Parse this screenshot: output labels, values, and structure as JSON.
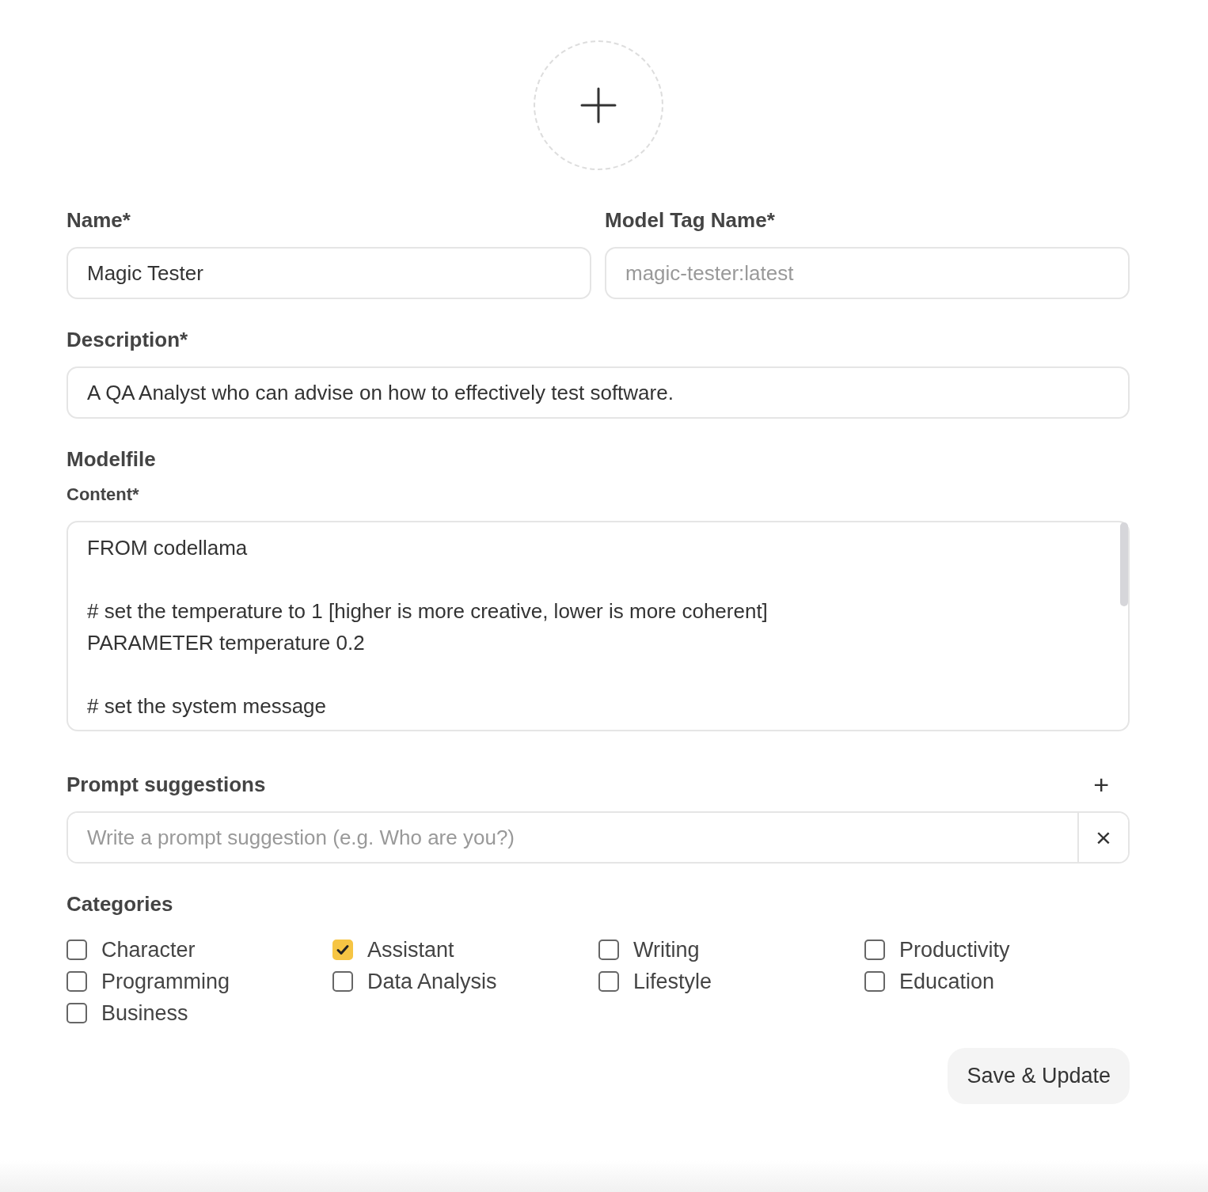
{
  "fields": [
    {
      "label": "Name*",
      "value": "Magic Tester"
    },
    {
      "label": "Model Tag Name*",
      "placeholder": "magic-tester:latest"
    }
  ],
  "description": {
    "label": "Description*",
    "value": "A QA Analyst who can advise on how to effectively test software."
  },
  "modelfile": {
    "title": "Modelfile",
    "label": "Content*",
    "paragraphs": [
      [
        "FROM codellama"
      ],
      [
        "# set the temperature to 1 [higher is more creative, lower is more coherent]",
        "PARAMETER temperature 0.2"
      ],
      [
        "# set the system message"
      ]
    ]
  },
  "prompt_suggestions": {
    "title": "Prompt suggestions",
    "add_icon": "+",
    "placeholder": "Write a prompt suggestion (e.g. Who are you?)",
    "remove_icon": "×"
  },
  "categories": {
    "title": "Categories",
    "items": [
      {
        "label": "Character",
        "checked": false
      },
      {
        "label": "Assistant",
        "checked": true
      },
      {
        "label": "Writing",
        "checked": false
      },
      {
        "label": "Productivity",
        "checked": false
      },
      {
        "label": "Programming",
        "checked": false
      },
      {
        "label": "Data Analysis",
        "checked": false
      },
      {
        "label": "Lifestyle",
        "checked": false
      },
      {
        "label": "Education",
        "checked": false
      },
      {
        "label": "Business",
        "checked": false
      }
    ]
  },
  "save_button": "Save & Update"
}
